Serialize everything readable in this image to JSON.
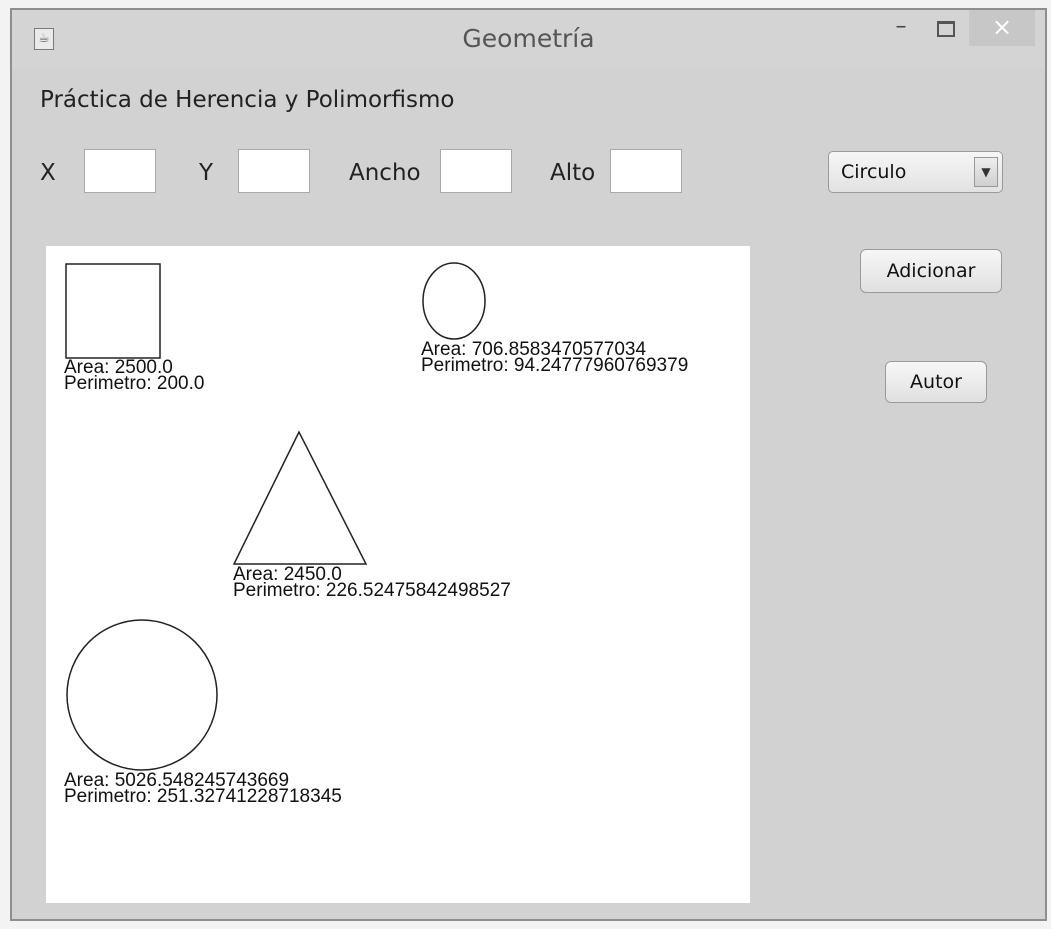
{
  "window": {
    "title": "Geometría",
    "icon": "java-icon",
    "controls": {
      "minimize": "–",
      "close": "×"
    }
  },
  "form": {
    "subtitle": "Práctica de Herencia y Polimorfismo",
    "x_label": "X",
    "y_label": "Y",
    "ancho_label": "Ancho",
    "alto_label": "Alto",
    "x_value": "",
    "y_value": "",
    "ancho_value": "",
    "alto_value": "",
    "shape_select": "Circulo"
  },
  "buttons": {
    "add": "Adicionar",
    "author": "Autor"
  },
  "shapes": [
    {
      "type": "square",
      "area": "Area: 2500.0",
      "perimeter": "Perimetro: 200.0"
    },
    {
      "type": "ellipse",
      "area": "Area: 706.8583470577034",
      "perimeter": "Perimetro: 94.24777960769379"
    },
    {
      "type": "triangle",
      "area": "Area: 2450.0",
      "perimeter": "Perimetro: 226.52475842498527"
    },
    {
      "type": "circle",
      "area": "Area: 5026.548245743669",
      "perimeter": "Perimetro: 251.32741228718345"
    }
  ]
}
